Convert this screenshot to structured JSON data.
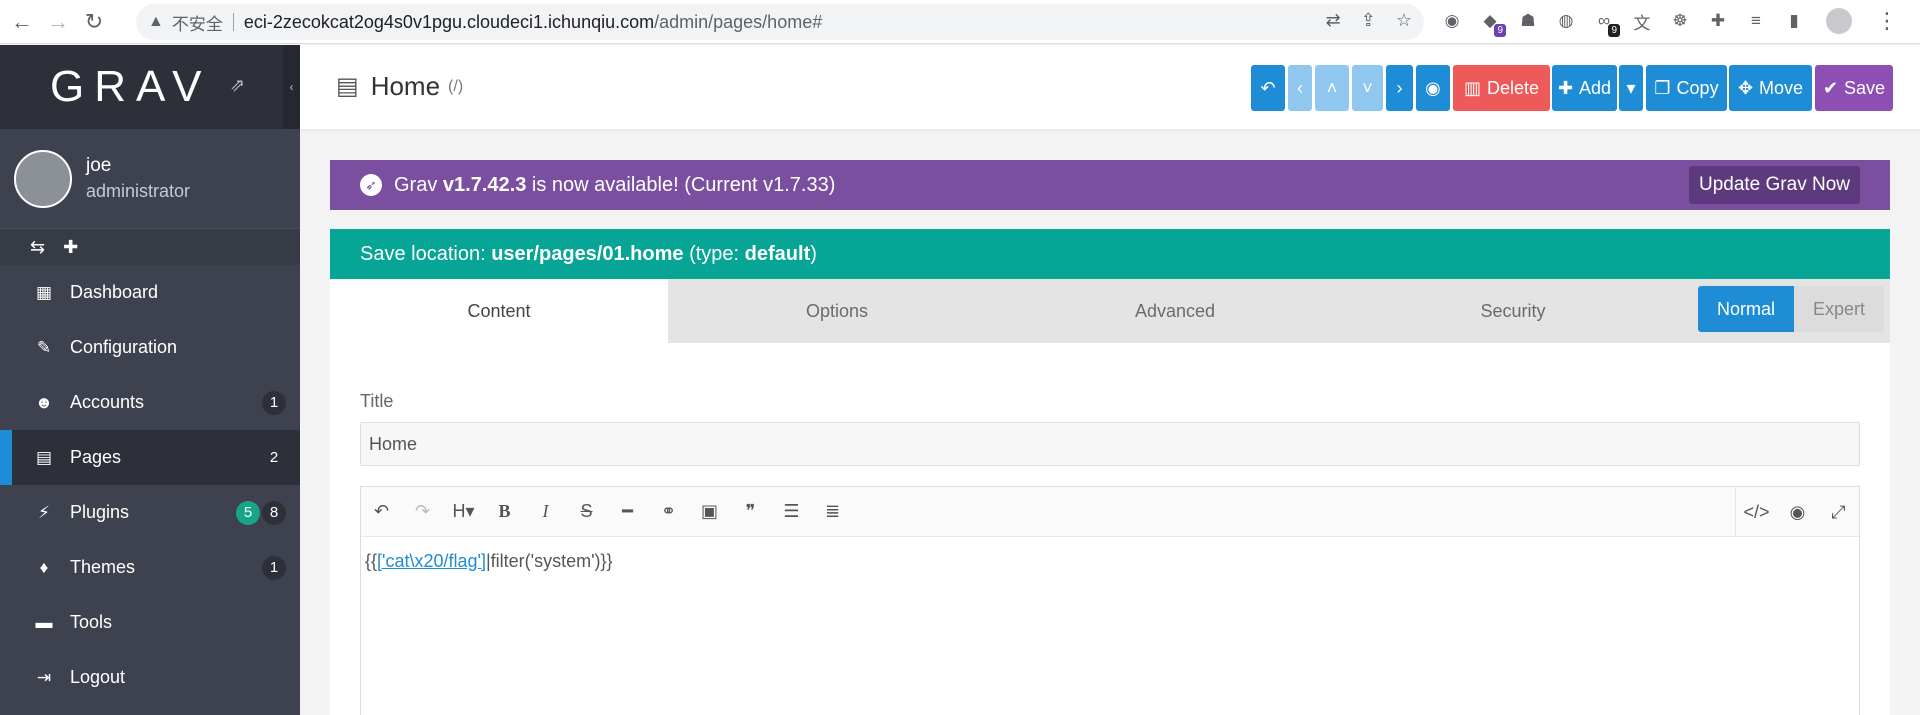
{
  "browser": {
    "insecure_label": "不安全",
    "url_host": "eci-2zecokcat2og4s0v1pgu.cloudeci1.ichunqiu.com",
    "url_path": "/admin/pages/home#",
    "ext_badge_1": "9",
    "ext_badge_2": "9"
  },
  "sidebar": {
    "logo": "GRAV",
    "user_name": "joe",
    "user_role": "administrator",
    "items": [
      {
        "label": "Dashboard",
        "count": ""
      },
      {
        "label": "Configuration",
        "count": ""
      },
      {
        "label": "Accounts",
        "count": "1"
      },
      {
        "label": "Pages",
        "count": "2"
      },
      {
        "label": "Plugins",
        "count": "8",
        "updates": "5"
      },
      {
        "label": "Themes",
        "count": "1"
      },
      {
        "label": "Tools",
        "count": ""
      },
      {
        "label": "Logout",
        "count": ""
      }
    ]
  },
  "header": {
    "title": "Home",
    "route": "(/)",
    "buttons": {
      "delete": "Delete",
      "add": "Add",
      "copy": "Copy",
      "move": "Move",
      "save": "Save"
    }
  },
  "update": {
    "prefix": "Grav",
    "version": "v1.7.42.3",
    "suffix": "is now available! (Current v1.7.33)",
    "button": "Update Grav Now"
  },
  "save_location": {
    "label": "Save location:",
    "path": "user/pages/01.home",
    "type_label": "(type:",
    "type_value": "default",
    "type_close": ")"
  },
  "tabs": [
    "Content",
    "Options",
    "Advanced",
    "Security"
  ],
  "mode": {
    "normal": "Normal",
    "expert": "Expert"
  },
  "form": {
    "title_label": "Title",
    "title_value": "Home",
    "editor_prefix": "{{",
    "editor_link": "['cat\\x20/flag']",
    "editor_suffix": "|filter('system')}}"
  },
  "colors": {
    "sidebar": "#3d424e",
    "accent_blue": "#1e8dd6",
    "update_purple": "#7a4f9f",
    "save_teal": "#07a596",
    "delete_red": "#ee5a5a"
  }
}
